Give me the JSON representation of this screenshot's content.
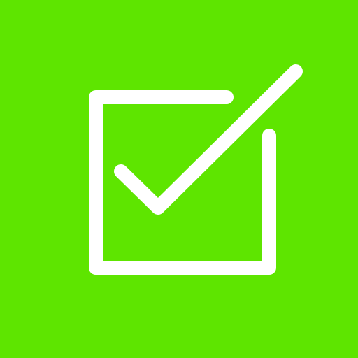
{
  "icon": {
    "name": "checkbox-checked-icon",
    "background_color": "#5EE500",
    "stroke_color": "#FFFFFF"
  }
}
